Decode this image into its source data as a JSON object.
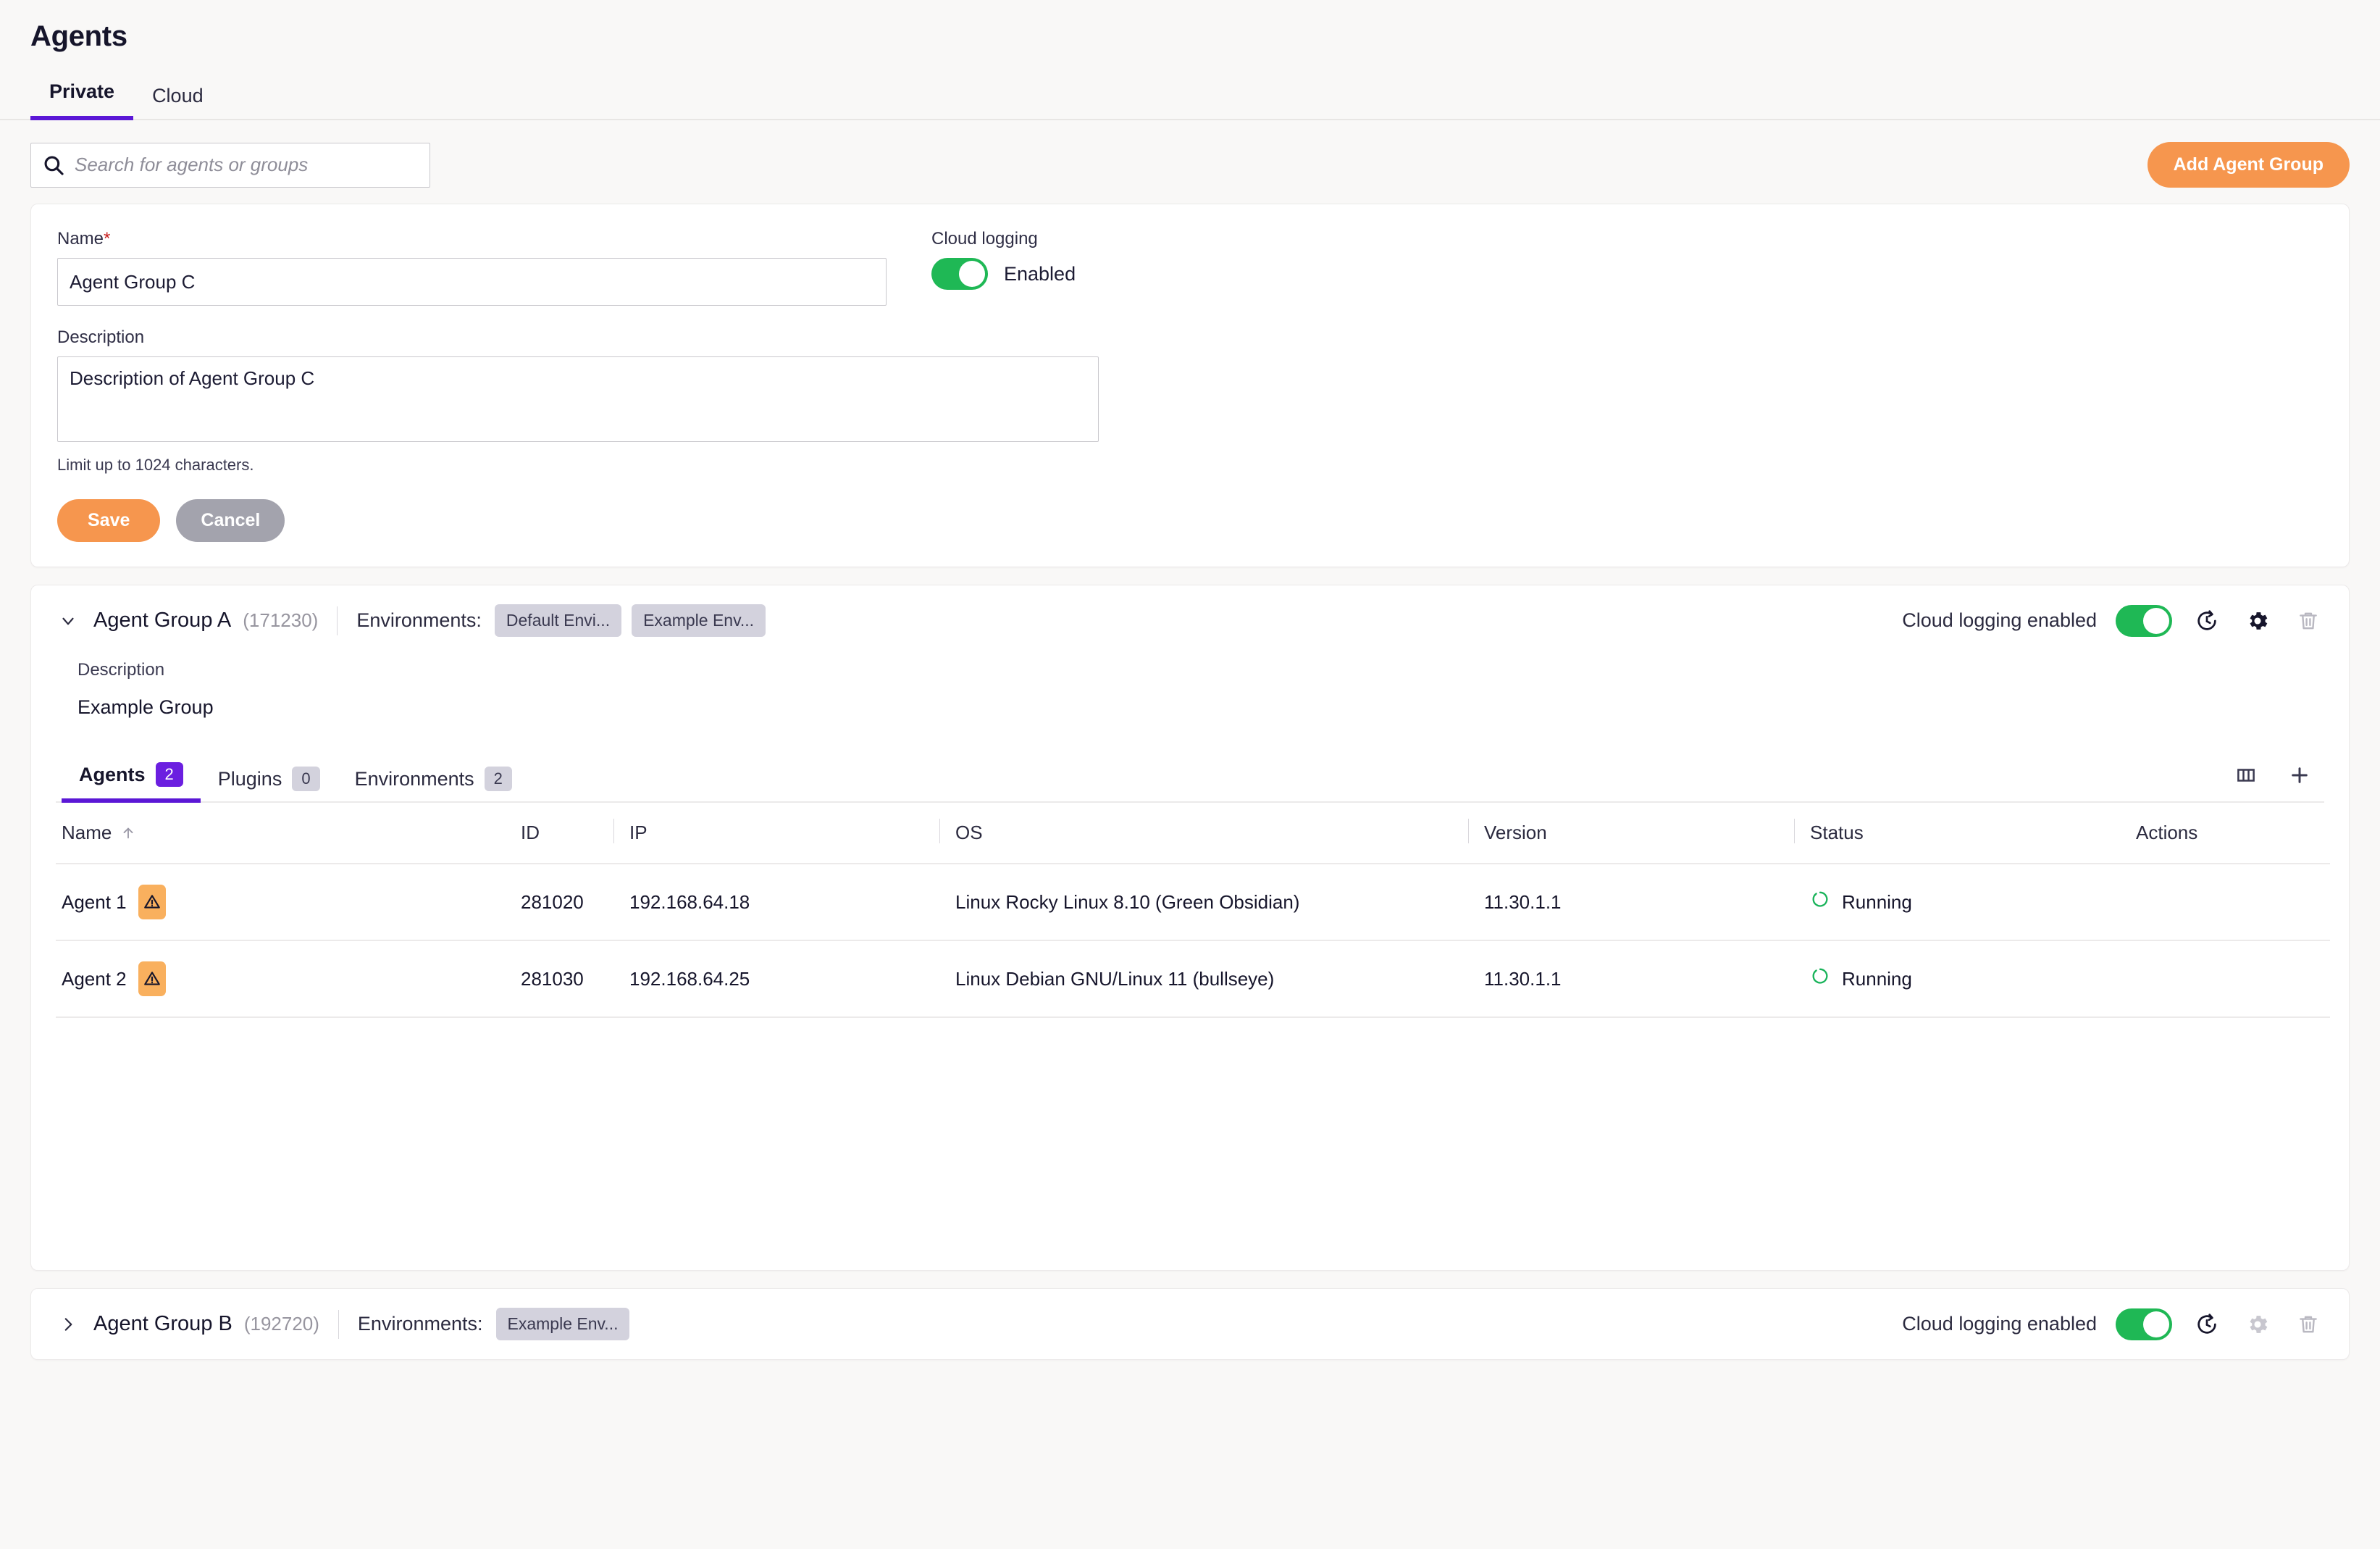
{
  "page": {
    "title": "Agents"
  },
  "top_tabs": [
    {
      "label": "Private",
      "active": true
    },
    {
      "label": "Cloud",
      "active": false
    }
  ],
  "search": {
    "placeholder": "Search for agents or groups",
    "value": "",
    "icon": "search-icon"
  },
  "actions": {
    "add_agent_group": "Add Agent Group"
  },
  "form": {
    "name_label": "Name",
    "required_mark": "*",
    "name_value": "Agent Group C",
    "description_label": "Description",
    "description_value": "Description of Agent Group C",
    "description_helper": "Limit up to 1024 characters.",
    "cloud_logging_label": "Cloud logging",
    "cloud_logging_state": "Enabled",
    "save_label": "Save",
    "cancel_label": "Cancel"
  },
  "groups": [
    {
      "name": "Agent Group A",
      "id": "(171230)",
      "environments_label": "Environments:",
      "environments": [
        "Default Envi...",
        "Example Env..."
      ],
      "expanded": true,
      "chevron": "chevron-down-icon",
      "cloud_logging_text": "Cloud logging enabled",
      "cloud_logging_on": true,
      "description_label": "Description",
      "description_value": "Example Group",
      "tabs": [
        {
          "label": "Agents",
          "count": "2",
          "active": true
        },
        {
          "label": "Plugins",
          "count": "0",
          "active": false
        },
        {
          "label": "Environments",
          "count": "2",
          "active": false
        }
      ],
      "table": {
        "columns": [
          "Name",
          "ID",
          "IP",
          "OS",
          "Version",
          "Status",
          "Actions"
        ],
        "sort_column": "Name",
        "sort_direction": "asc",
        "rows": [
          {
            "name": "Agent 1",
            "warning": true,
            "id": "281020",
            "ip": "192.168.64.18",
            "os": "Linux Rocky Linux 8.10 (Green Obsidian)",
            "version": "11.30.1.1",
            "status": "Running",
            "actions": ""
          },
          {
            "name": "Agent 2",
            "warning": true,
            "id": "281030",
            "ip": "192.168.64.25",
            "os": "Linux Debian GNU/Linux 11 (bullseye)",
            "version": "11.30.1.1",
            "status": "Running",
            "actions": ""
          }
        ]
      }
    },
    {
      "name": "Agent Group B",
      "id": "(192720)",
      "environments_label": "Environments:",
      "environments": [
        "Example Env..."
      ],
      "expanded": false,
      "chevron": "chevron-right-icon",
      "cloud_logging_text": "Cloud logging enabled",
      "cloud_logging_on": true
    }
  ],
  "colors": {
    "accent_purple": "#5b17d6",
    "accent_orange": "#f6964e",
    "toggle_green": "#1fb855",
    "status_green": "#19b35a",
    "warning_orange": "#f9b05e",
    "page_background": "#f9f8f7"
  }
}
